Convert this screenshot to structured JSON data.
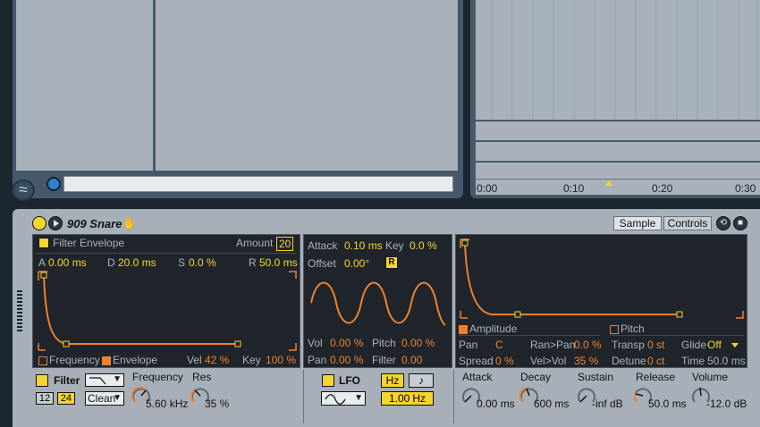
{
  "device": {
    "title": "909 Snare",
    "tabs": [
      "Sample",
      "Controls"
    ]
  },
  "filter_env": {
    "title": "Filter Envelope",
    "amount_label": "Amount",
    "amount_value": "20",
    "params": [
      {
        "label": "A",
        "value": "0.00 ms"
      },
      {
        "label": "D",
        "value": "20.0 ms"
      },
      {
        "label": "S",
        "value": "0.0 %"
      },
      {
        "label": "R",
        "value": "50.0 ms"
      }
    ],
    "mod_frequency": "Frequency",
    "mod_envelope": "Envelope",
    "vel_label": "Vel",
    "vel_value": "42 %",
    "key_label": "Key",
    "key_value": "100 %"
  },
  "lfo_panel": {
    "attack_label": "Attack",
    "attack_value": "0.10 ms",
    "key_label": "Key",
    "key_value": "0.0 %",
    "offset_label": "Offset",
    "offset_value": "0.00°",
    "retrig": "R",
    "vol_label": "Vol",
    "vol_value": "0.00 %",
    "pitch_label": "Pitch",
    "pitch_value": "0.00 %",
    "pan_label": "Pan",
    "pan_value": "0.00 %",
    "filter_label": "Filter",
    "filter_value": "0.00"
  },
  "amp_panel": {
    "amplitude": "Amplitude",
    "pitch": "Pitch",
    "pan_label": "Pan",
    "pan_value": "C",
    "ranpan_label": "Ran>Pan",
    "ranpan_value": "0.0 %",
    "transp_label": "Transp",
    "transp_value": "0 st",
    "glide_label": "Glide",
    "glide_value": "Off",
    "spread_label": "Spread",
    "spread_value": "0 %",
    "velvol_label": "Vel>Vol",
    "velvol_value": "35 %",
    "detune_label": "Detune",
    "detune_value": "0 ct",
    "time_label": "Time",
    "time_value": "50.0 ms"
  },
  "filter_section": {
    "label": "Filter",
    "slope_12": "12",
    "slope_24": "24",
    "type_value": "Clean",
    "frequency_label": "Frequency",
    "frequency_value": "5.60 kHz",
    "res_label": "Res",
    "res_value": "35 %"
  },
  "lfo_section": {
    "label": "LFO",
    "hz": "Hz",
    "note": "♪",
    "rate_value": "1.00",
    "rate_unit": "Hz"
  },
  "amp_env": [
    {
      "label": "Attack",
      "value": "0.00 ms"
    },
    {
      "label": "Decay",
      "value": "600 ms"
    },
    {
      "label": "Sustain",
      "value": "-inf dB"
    },
    {
      "label": "Release",
      "value": "50.0 ms"
    },
    {
      "label": "Volume",
      "value": "-12.0 dB"
    }
  ],
  "ruler": [
    "0:00",
    "0:10",
    "0:20",
    "0:30"
  ],
  "colors": {
    "accent": "#f0822f",
    "value": "#f5d52e",
    "panel": "#1f252b",
    "chrome": "#a7b0b8"
  }
}
